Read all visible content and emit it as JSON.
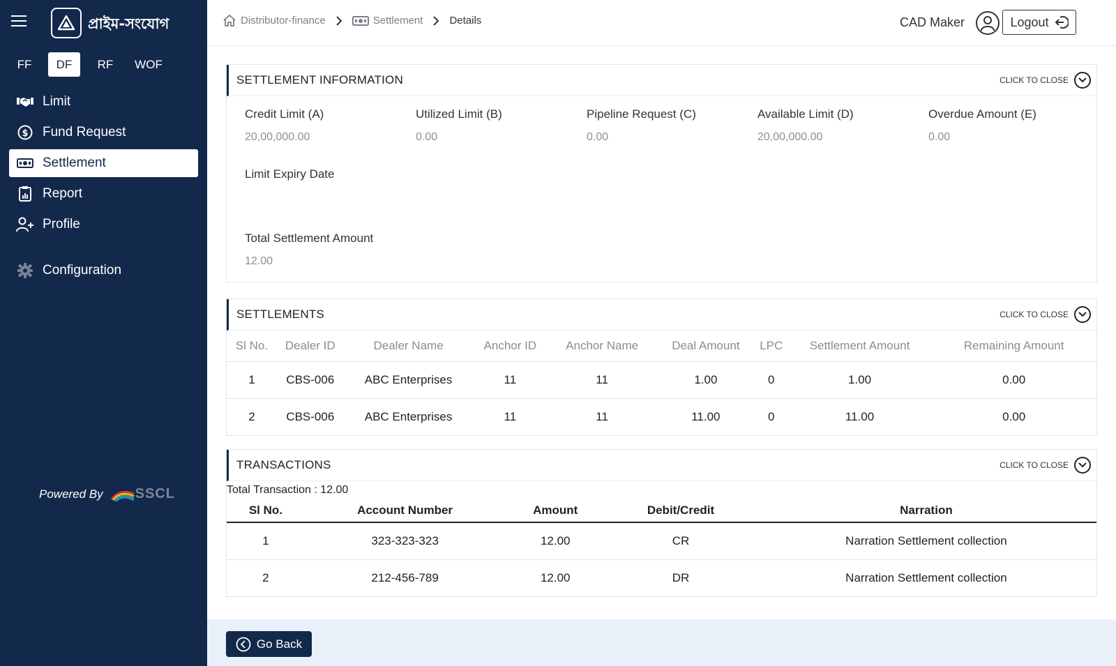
{
  "brand": {
    "logo_text": "প্রাইম-সংযোগ",
    "logo_icon": "prime-logo-icon"
  },
  "product_tabs": [
    "FF",
    "DF",
    "RF",
    "WOF"
  ],
  "active_tab": "DF",
  "nav": {
    "limit": "Limit",
    "fund_request": "Fund Request",
    "settlement": "Settlement",
    "report": "Report",
    "profile": "Profile",
    "configuration": "Configuration"
  },
  "powered_by": {
    "label": "Powered By",
    "company": "SSCL"
  },
  "breadcrumb": {
    "home": "Distributor-finance",
    "section": "Settlement",
    "current": "Details"
  },
  "user": {
    "role": "CAD Maker",
    "logout_label": "Logout"
  },
  "settlement_info": {
    "title": "SETTLEMENT INFORMATION",
    "toggle_label": "CLICK TO CLOSE",
    "credit_limit_label": "Credit Limit (A)",
    "credit_limit_value": "20,00,000.00",
    "utilized_limit_label": "Utilized Limit (B)",
    "utilized_limit_value": "0.00",
    "pipeline_request_label": "Pipeline Request (C)",
    "pipeline_request_value": "0.00",
    "available_limit_label": "Available Limit (D)",
    "available_limit_value": "20,00,000.00",
    "overdue_amount_label": "Overdue Amount (E)",
    "overdue_amount_value": "0.00",
    "limit_expiry_label": "Limit Expiry Date",
    "limit_expiry_value": "",
    "total_settlement_label": "Total Settlement Amount",
    "total_settlement_value": "12.00"
  },
  "settlements": {
    "title": "SETTLEMENTS",
    "toggle_label": "CLICK TO CLOSE",
    "headers": [
      "Sl No.",
      "Dealer ID",
      "Dealer Name",
      "Anchor ID",
      "Anchor Name",
      "Deal Amount",
      "LPC",
      "Settlement Amount",
      "Remaining Amount"
    ],
    "rows": [
      [
        "1",
        "CBS-006",
        "ABC Enterprises",
        "11",
        "11",
        "1.00",
        "0",
        "1.00",
        "0.00"
      ],
      [
        "2",
        "CBS-006",
        "ABC Enterprises",
        "11",
        "11",
        "11.00",
        "0",
        "11.00",
        "0.00"
      ]
    ]
  },
  "transactions": {
    "title": "TRANSACTIONS",
    "toggle_label": "CLICK TO CLOSE",
    "total_label": "Total Transaction : 12.00",
    "headers": [
      "Sl No.",
      "Account Number",
      "Amount",
      "Debit/Credit",
      "Narration"
    ],
    "rows": [
      [
        "1",
        "323-323-323",
        "12.00",
        "CR",
        "Narration Settlement collection"
      ],
      [
        "2",
        "212-456-789",
        "12.00",
        "DR",
        "Narration Settlement collection"
      ]
    ]
  },
  "go_back_label": "Go Back"
}
